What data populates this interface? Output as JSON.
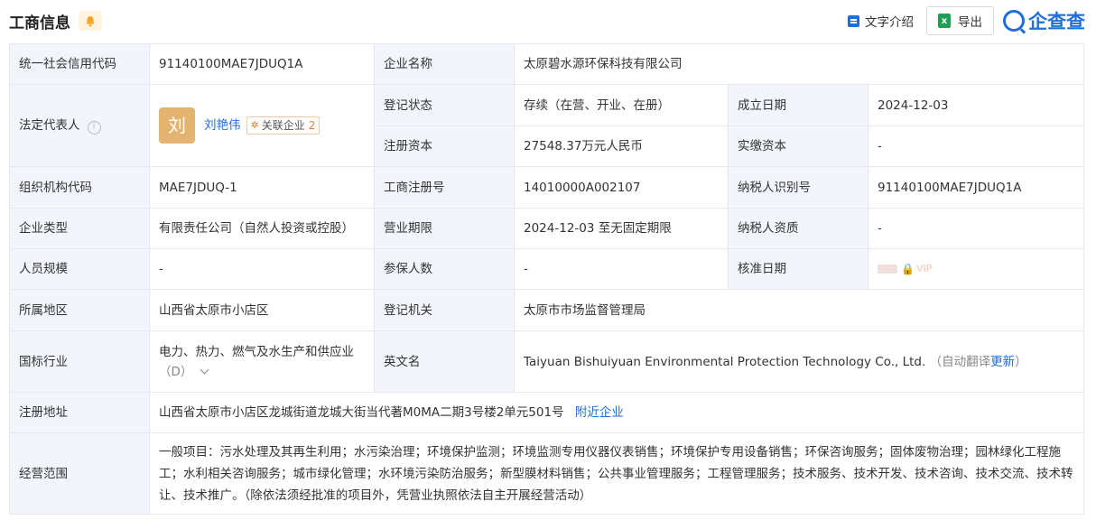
{
  "header": {
    "title": "工商信息",
    "bell_icon": "bell-icon",
    "text_intro": "文字介绍",
    "export": "导出",
    "logo": "企查查",
    "accent": "#1e6fd9"
  },
  "rows": {
    "credit_code": {
      "label": "统一社会信用代码",
      "value": "91140100MAE7JDUQ1A"
    },
    "company_name": {
      "label": "企业名称",
      "value": "太原碧水源环保科技有限公司"
    },
    "legal_rep": {
      "label": "法定代表人",
      "avatar": "刘",
      "name": "刘艳伟",
      "related_label": "关联企业",
      "related_count": "2"
    },
    "reg_status": {
      "label": "登记状态",
      "value": "存续（在营、开业、在册）"
    },
    "est_date": {
      "label": "成立日期",
      "value": "2024-12-03"
    },
    "reg_capital": {
      "label": "注册资本",
      "value": "27548.37万元人民币"
    },
    "paid_capital": {
      "label": "实缴资本",
      "value": "-"
    },
    "org_code": {
      "label": "组织机构代码",
      "value": "MAE7JDUQ-1"
    },
    "biz_reg_no": {
      "label": "工商注册号",
      "value": "14010000A002107"
    },
    "taxpayer_id": {
      "label": "纳税人识别号",
      "value": "91140100MAE7JDUQ1A"
    },
    "company_type": {
      "label": "企业类型",
      "value": "有限责任公司（自然人投资或控股）"
    },
    "biz_term": {
      "label": "营业期限",
      "value": "2024-12-03 至无固定期限"
    },
    "taxpayer_qual": {
      "label": "纳税人资质",
      "value": "-"
    },
    "staff_size": {
      "label": "人员规模",
      "value": "-"
    },
    "insured": {
      "label": "参保人数",
      "value": "-"
    },
    "approval_date": {
      "label": "核准日期",
      "value": "VIP"
    },
    "region": {
      "label": "所属地区",
      "value": "山西省太原市小店区"
    },
    "reg_authority": {
      "label": "登记机关",
      "value": "太原市市场监督管理局"
    },
    "industry": {
      "label": "国标行业",
      "value_line1": "电力、热力、燃气及水生产和供应业",
      "value_line2": "（D）"
    },
    "english_name": {
      "label": "英文名",
      "value": "Taiyuan Bishuiyuan Environmental Protection Technology Co., Ltd.",
      "note": "（自动翻译",
      "update": "更新",
      "note_end": "）"
    },
    "reg_address": {
      "label": "注册地址",
      "value": "山西省太原市小店区龙城街道龙城大街当代著M0MA二期3号楼2单元501号",
      "nearby": "附近企业"
    },
    "biz_scope": {
      "label": "经营范围",
      "value": "一般项目：污水处理及其再生利用；水污染治理；环境保护监测；环境监测专用仪器仪表销售；环境保护专用设备销售；环保咨询服务；固体废物治理；园林绿化工程施工；水利相关咨询服务；城市绿化管理；水环境污染防治服务；新型膜材料销售；公共事业管理服务；工程管理服务；技术服务、技术开发、技术咨询、技术交流、技术转让、技术推广。（除依法须经批准的项目外，凭营业执照依法自主开展经营活动）"
    }
  }
}
